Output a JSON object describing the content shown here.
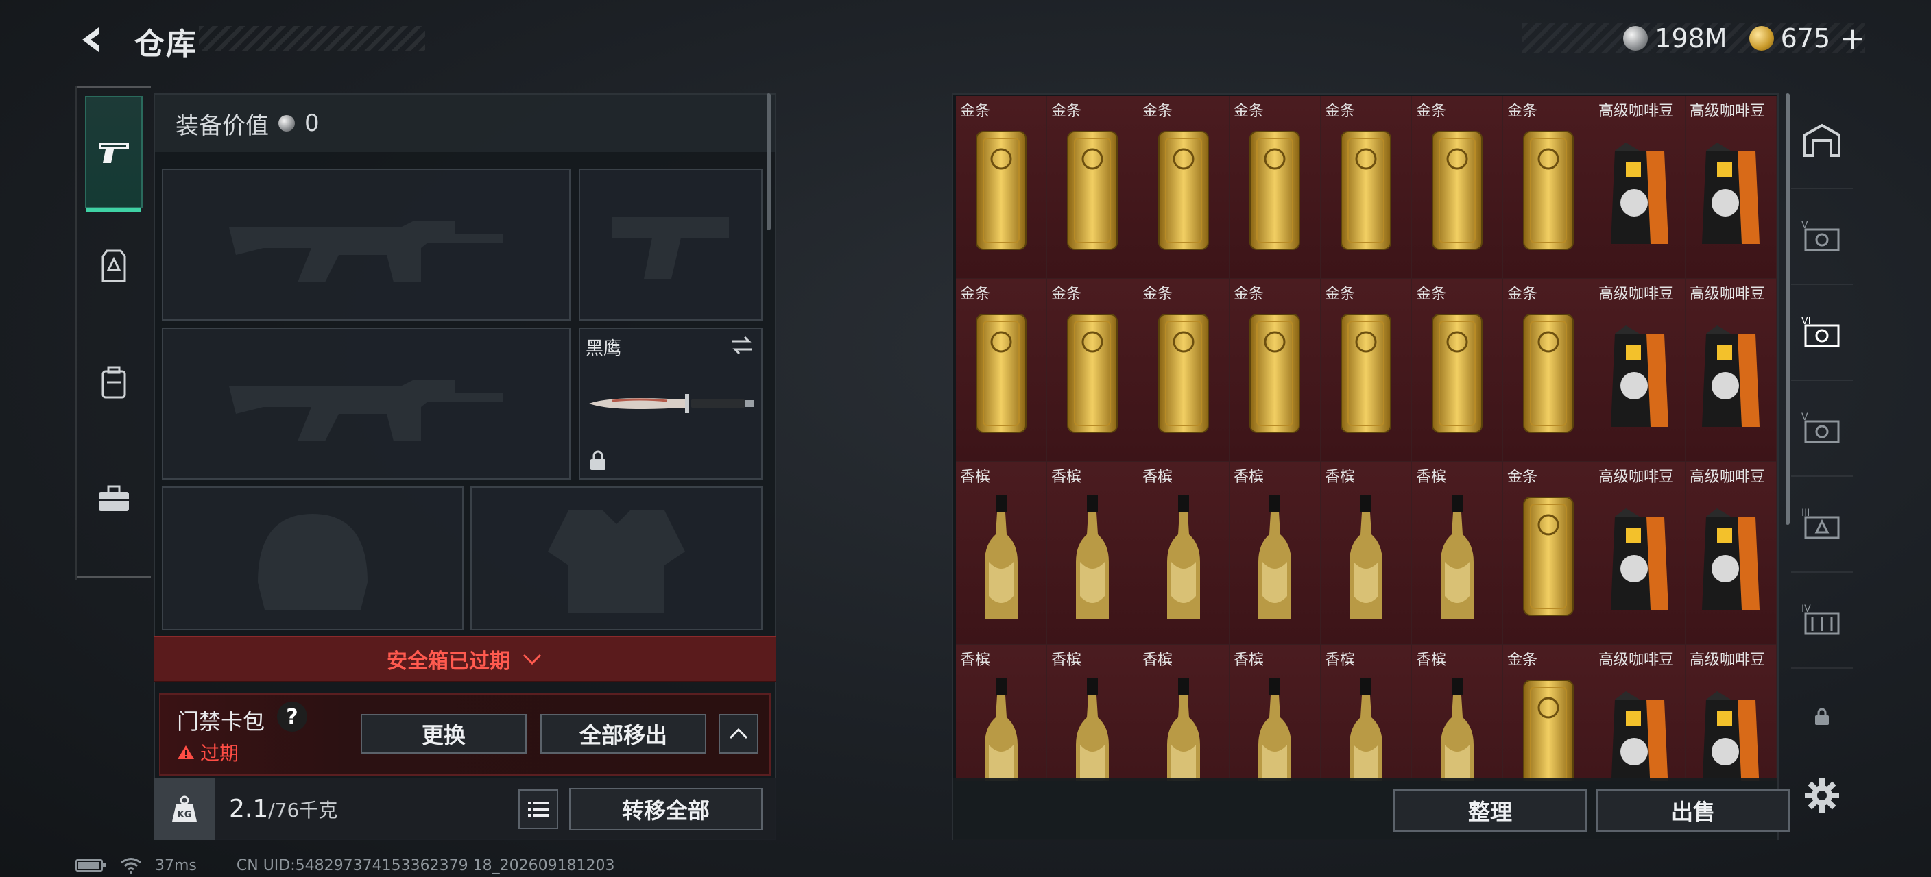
{
  "header": {
    "title": "仓库",
    "currency": [
      {
        "icon": "silver-coin-icon",
        "value": "198M"
      },
      {
        "icon": "gold-coin-icon",
        "value": "675"
      }
    ],
    "currency_plus": "+"
  },
  "equipment": {
    "value_label": "装备价值",
    "value": "0",
    "melee_name": "黑鹰",
    "safe_box_status": "安全箱已过期",
    "card_pack": {
      "title": "门禁卡包",
      "help": "?",
      "status": "过期"
    },
    "replace_label": "更换",
    "move_all_label": "全部移出",
    "weight": "2.1",
    "weight_max": "/76千克",
    "transfer_all_label": "转移全部"
  },
  "storage": {
    "sort_label": "整理",
    "sell_label": "出售",
    "rows": [
      [
        "金条",
        "金条",
        "金条",
        "金条",
        "金条",
        "金条",
        "金条",
        "高级咖啡豆",
        "高级咖啡豆"
      ],
      [
        "金条",
        "金条",
        "金条",
        "金条",
        "金条",
        "金条",
        "金条",
        "高级咖啡豆",
        "高级咖啡豆"
      ],
      [
        "香槟",
        "香槟",
        "香槟",
        "香槟",
        "香槟",
        "香槟",
        "金条",
        "高级咖啡豆",
        "高级咖啡豆"
      ],
      [
        "香槟",
        "香槟",
        "香槟",
        "香槟",
        "香槟",
        "香槟",
        "金条",
        "高级咖啡豆",
        "高级咖啡豆"
      ]
    ]
  },
  "status_bar": {
    "ping": "37ms",
    "uid": "CN UID:548297374153362379 18_202609181203"
  },
  "colors": {
    "accent": "#3fd2a5",
    "alert": "#ff4d45",
    "cell_bg": "#4b1c20"
  }
}
